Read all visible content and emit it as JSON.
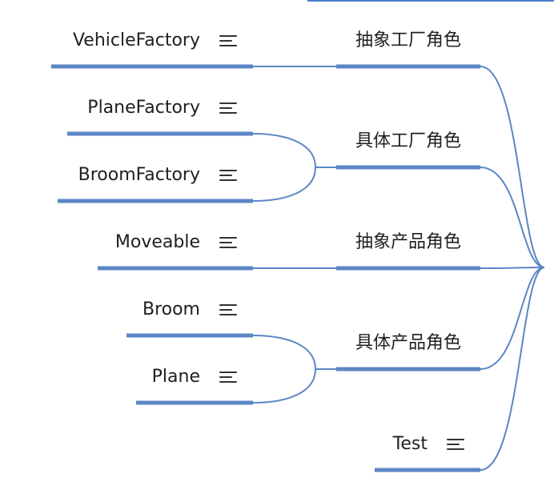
{
  "theme": {
    "line_color": "#5b86c5",
    "top_line_color": "#4a7fc7",
    "text_color": "#1f1f1f",
    "icon_color": "#333333"
  },
  "icon_name": "notes-icon",
  "groups": [
    {
      "label": "抽象工厂角色",
      "children": [
        "VehicleFactory"
      ]
    },
    {
      "label": "具体工厂角色",
      "children": [
        "PlaneFactory",
        "BroomFactory"
      ]
    },
    {
      "label": "抽象产品角色",
      "children": [
        "Moveable"
      ]
    },
    {
      "label": "具体产品角色",
      "children": [
        "Broom",
        "Plane"
      ]
    }
  ],
  "standalone": {
    "label": "Test"
  }
}
